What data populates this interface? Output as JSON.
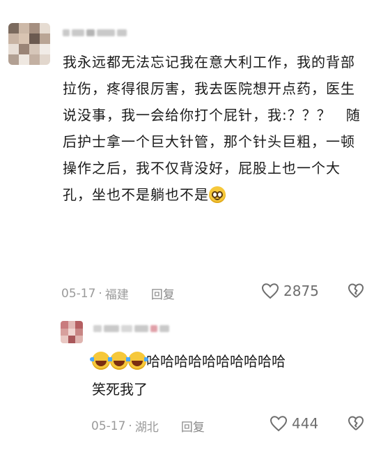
{
  "comment": {
    "username": "",
    "text": "我永远都无法忘记我在意大利工作，我的背部拉伤，疼得很厉害，我去医院想开点药，医生说没事，我一会给你打个屁针，我:？？？　随后护士拿一个巨大针管，那个针头巨粗，一顿操作之后，我不仅背没好，屁股上也一个大孔，坐也不是躺也不是",
    "emoji_icon": "smiling-face-icon",
    "date": "05-17",
    "location": "福建",
    "reply_label": "回复",
    "likes": "2875"
  },
  "reply": {
    "username": "",
    "emoji_icons": [
      "laughing-crying-icon",
      "laughing-crying-icon",
      "laughing-crying-icon"
    ],
    "text_line1": "哈哈哈哈哈哈哈哈哈哈",
    "text_line2": "笑死我了",
    "date": "05-17",
    "location": "湖北",
    "reply_label": "回复",
    "likes": "444"
  },
  "colors": {
    "text": "#1a1a1a",
    "meta": "#9a9a9a",
    "emoji": "#f6c83a"
  }
}
